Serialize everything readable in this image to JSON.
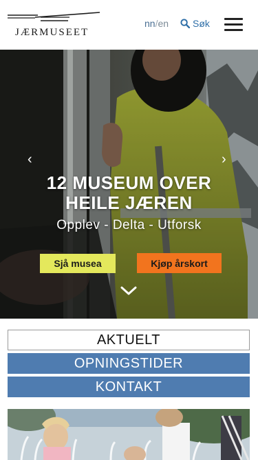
{
  "header": {
    "logo_text": "JÆRMUSEET",
    "lang_nn": "nn",
    "lang_sep": "/",
    "lang_en": "en",
    "search_label": "Søk",
    "icons": {
      "search": "search-icon",
      "menu": "hamburger-menu-icon"
    }
  },
  "hero": {
    "title_line1": "12 MUSEUM OVER",
    "title_line2": "HEILE JÆREN",
    "subtitle": "Opplev - Delta - Utforsk",
    "btn_museum": "Sjå musea",
    "btn_card": "Kjøp årskort",
    "colors": {
      "btn_museum": "#e4e85c",
      "btn_card": "#f2741e"
    }
  },
  "quicklinks": [
    {
      "label": "AKTUELT"
    },
    {
      "label": "OPNINGSTIDER"
    },
    {
      "label": "KONTAKT"
    }
  ],
  "colors": {
    "accent_blue": "#4f7cb0",
    "link_blue": "#2f6fa8"
  }
}
